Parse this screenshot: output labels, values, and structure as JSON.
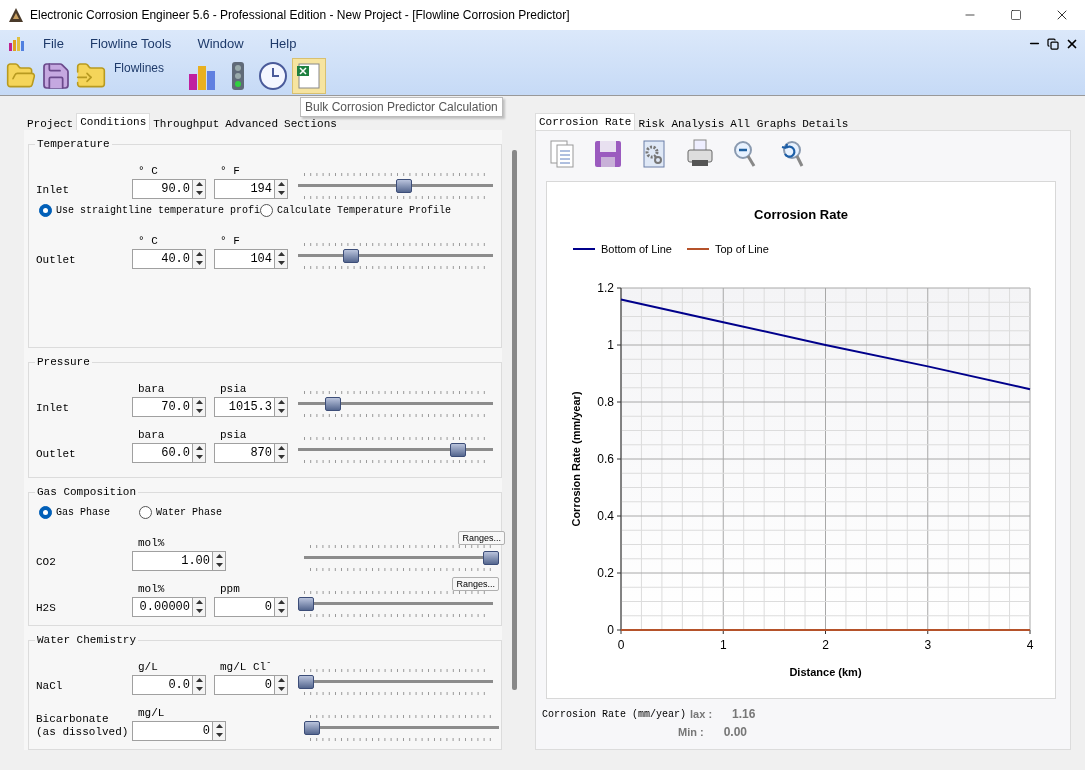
{
  "window": {
    "title": "Electronic Corrosion Engineer 5.6 - Professional Edition - New Project - [Flowline Corrosion Predictor]"
  },
  "menu": [
    "File",
    "Flowline Tools",
    "Window",
    "Help"
  ],
  "toolbar": {
    "label": "Flowlines",
    "tooltip": "Bulk Corrosion Predictor Calculation"
  },
  "left_tabs": [
    {
      "label": "Project",
      "selected": false
    },
    {
      "label": "Conditions",
      "selected": true
    },
    {
      "label": "Throughput",
      "selected": false
    },
    {
      "label": "Advanced",
      "selected": false
    },
    {
      "label": "Sections",
      "selected": false
    }
  ],
  "sections": [
    {
      "title": "Temperature",
      "rows": [
        {
          "kind": "input",
          "label": "Inlet",
          "units": [
            "° C",
            "° F"
          ],
          "values": [
            "90.0",
            "194"
          ],
          "level": 0.55
        },
        {
          "kind": "radios",
          "options": [
            {
              "label": "Use straightline temperature profi",
              "selected": true
            },
            {
              "label": "Calculate Temperature Profile",
              "selected": false
            }
          ]
        },
        {
          "kind": "input",
          "label": "Outlet",
          "units": [
            "° C",
            "° F"
          ],
          "values": [
            "40.0",
            "104"
          ],
          "level": 0.25
        }
      ]
    },
    {
      "title": "Pressure",
      "rows": [
        {
          "kind": "input",
          "label": "Inlet",
          "units": [
            "bara",
            "psia"
          ],
          "values": [
            "70.0",
            "1015.3"
          ],
          "level": 0.15
        },
        {
          "kind": "input",
          "label": "Outlet",
          "units": [
            "bara",
            "psia"
          ],
          "values": [
            "60.0",
            "870"
          ],
          "level": 0.85
        }
      ]
    },
    {
      "title": "Gas Composition",
      "rows": [
        {
          "kind": "radios",
          "options": [
            {
              "label": "Gas Phase",
              "selected": true
            },
            {
              "label": "Water Phase",
              "selected": false
            }
          ]
        },
        {
          "kind": "input",
          "label": "CO2",
          "units": [
            "mol%"
          ],
          "values": [
            "1.00"
          ],
          "level": 1,
          "button": "Ranges..."
        },
        {
          "kind": "input",
          "label": "H2S",
          "units": [
            "mol%",
            "ppm"
          ],
          "values": [
            "0.00000",
            "0"
          ],
          "level": 0,
          "button": "Ranges..."
        }
      ]
    },
    {
      "title": "Water Chemistry",
      "rows": [
        {
          "kind": "input",
          "label": "NaCl",
          "units": [
            "g/L",
            "mg/L Cl$^{-}$"
          ],
          "values": [
            "0.0",
            "0"
          ],
          "level": 0
        },
        {
          "kind": "input",
          "label": "Bicarbonate\n(as dissolved)",
          "units": [
            "mg/L"
          ],
          "values": [
            "0"
          ],
          "level": 0
        }
      ]
    }
  ],
  "right_tabs": [
    {
      "label": "Corrosion Rate",
      "selected": true
    },
    {
      "label": "Risk Analysis",
      "selected": false
    },
    {
      "label": "All Graphs",
      "selected": false
    },
    {
      "label": "Details",
      "selected": false
    }
  ],
  "chart_data": {
    "type": "line",
    "title": "Corrosion Rate",
    "xlabel": "Distance (km)",
    "ylabel": "Corrosion Rate (mm/year)",
    "x": [
      0,
      1,
      2,
      3,
      4
    ],
    "series": [
      {
        "name": "Bottom of Line",
        "color": "#00008b",
        "values": [
          1.16,
          1.08,
          1.0,
          0.925,
          0.845
        ]
      },
      {
        "name": "Top of Line",
        "color": "#b5522a",
        "values": [
          0,
          0,
          0,
          0,
          0
        ]
      }
    ],
    "xlim": [
      0,
      4
    ],
    "ylim": [
      0,
      1.2
    ],
    "grid": true,
    "legend": true,
    "xticks": [
      0,
      1,
      2,
      3,
      4
    ],
    "yticks": [
      0,
      0.2,
      0.4,
      0.6,
      0.8,
      1,
      1.2
    ]
  },
  "summary": {
    "label": "Corrosion Rate (mm/year)",
    "stats": [
      {
        "label": "lax :",
        "value": "1.16"
      },
      {
        "label": "Min :",
        "value": "0.00"
      }
    ]
  }
}
